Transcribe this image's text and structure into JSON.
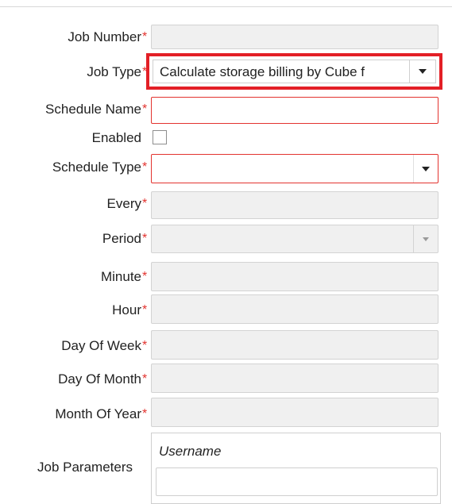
{
  "form": {
    "required_marker": "*",
    "job_number": {
      "label": "Job Number",
      "value": ""
    },
    "job_type": {
      "label": "Job Type",
      "value": "Calculate storage billing by Cube f"
    },
    "schedule_name": {
      "label": "Schedule Name",
      "value": ""
    },
    "enabled": {
      "label": "Enabled",
      "checked": false
    },
    "schedule_type": {
      "label": "Schedule Type",
      "value": ""
    },
    "every": {
      "label": "Every",
      "value": ""
    },
    "period": {
      "label": "Period",
      "value": ""
    },
    "minute": {
      "label": "Minute",
      "value": ""
    },
    "hour": {
      "label": "Hour",
      "value": ""
    },
    "day_of_week": {
      "label": "Day Of Week",
      "value": ""
    },
    "day_of_month": {
      "label": "Day Of Month",
      "value": ""
    },
    "month_of_year": {
      "label": "Month Of Year",
      "value": ""
    },
    "job_parameters": {
      "label": "Job Parameters",
      "username_label": "Username",
      "username_value": ""
    }
  },
  "colors": {
    "required": "#e3332f",
    "highlight": "#e31f26",
    "disabled_field": "#f0f0f0"
  }
}
